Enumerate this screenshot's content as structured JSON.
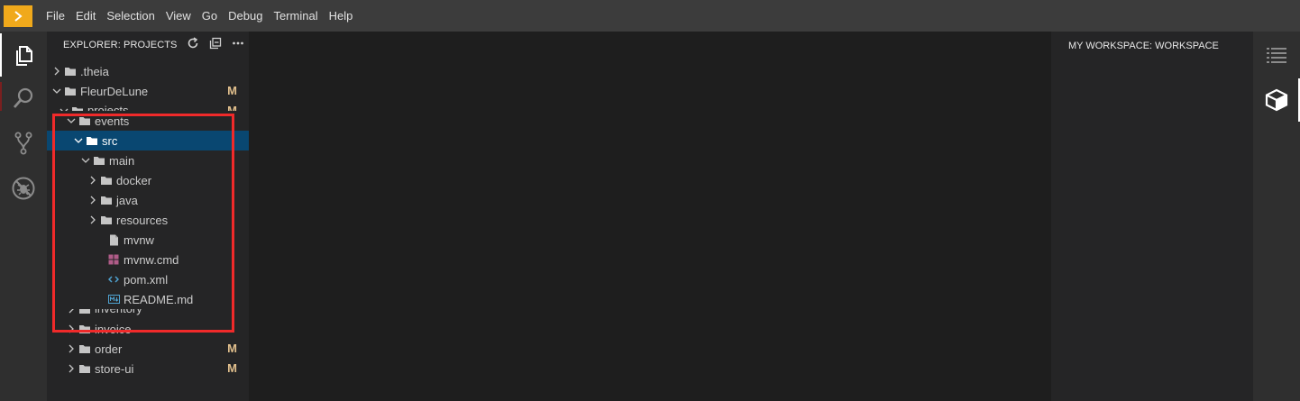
{
  "menubar": {
    "items": [
      "File",
      "Edit",
      "Selection",
      "View",
      "Go",
      "Debug",
      "Terminal",
      "Help"
    ]
  },
  "activity_bar": {
    "icons": [
      "explorer-icon",
      "search-icon",
      "source-control-icon",
      "debug-icon"
    ]
  },
  "explorer": {
    "title": "EXPLORER: PROJECTS",
    "header_icons": [
      "refresh-icon",
      "collapse-all-icon",
      "more-icon"
    ],
    "tree": [
      {
        "label": ".theia",
        "badge": ""
      },
      {
        "label": "FleurDeLune",
        "badge": "M"
      },
      {
        "label": "projects",
        "badge": "M"
      },
      {
        "label": "events",
        "badge": ""
      },
      {
        "label": "src",
        "badge": ""
      },
      {
        "label": "main",
        "badge": ""
      },
      {
        "label": "docker",
        "badge": ""
      },
      {
        "label": "java",
        "badge": ""
      },
      {
        "label": "resources",
        "badge": ""
      },
      {
        "label": "mvnw",
        "badge": ""
      },
      {
        "label": "mvnw.cmd",
        "badge": ""
      },
      {
        "label": "pom.xml",
        "badge": ""
      },
      {
        "label": "README.md",
        "badge": ""
      },
      {
        "label": "inventory",
        "badge": ""
      },
      {
        "label": "invoice",
        "badge": ""
      },
      {
        "label": "order",
        "badge": "M"
      },
      {
        "label": "store-ui",
        "badge": "M"
      }
    ]
  },
  "right_panel": {
    "title": "MY WORKSPACE: WORKSPACE"
  },
  "right_bar": {
    "icons": [
      "outline-icon",
      "workspace-cube-icon"
    ]
  },
  "colors": {
    "menubar": "#3c3c3c",
    "sidebar": "#252526",
    "editor": "#1e1e1e",
    "selection": "#094771",
    "modified_badge": "#e2c08d",
    "highlight_box": "#f02a2a",
    "logo": "#f0a91b"
  }
}
